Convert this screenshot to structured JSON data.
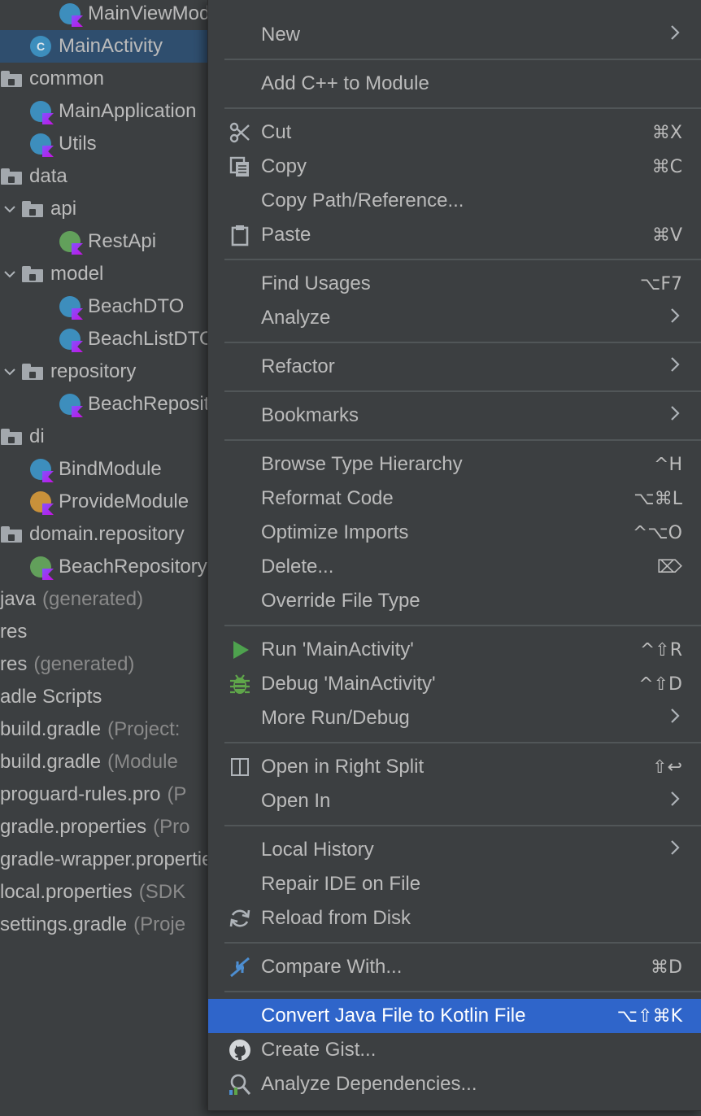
{
  "tree": {
    "rows": [
      {
        "label": "MainViewModel",
        "hint": "",
        "indent": 72,
        "icon": "kotlin-class-icon",
        "color": "blue",
        "arrow": ""
      },
      {
        "label": "MainActivity",
        "hint": "",
        "indent": 36,
        "icon": "java-class-icon",
        "color": "blue",
        "arrow": "",
        "selected": true
      },
      {
        "label": "common",
        "hint": "",
        "indent": 0,
        "icon": "package-folder-icon",
        "arrow": ""
      },
      {
        "label": "MainApplication",
        "hint": "",
        "indent": 36,
        "icon": "kotlin-class-icon",
        "color": "blue",
        "arrow": ""
      },
      {
        "label": "Utils",
        "hint": "",
        "indent": 36,
        "icon": "kotlin-class-icon",
        "color": "blue",
        "arrow": ""
      },
      {
        "label": "data",
        "hint": "",
        "indent": 0,
        "icon": "package-folder-icon",
        "arrow": ""
      },
      {
        "label": "api",
        "hint": "",
        "indent": 0,
        "icon": "package-folder-icon",
        "arrow": "down"
      },
      {
        "label": "RestApi",
        "hint": "",
        "indent": 72,
        "icon": "kotlin-interface-icon",
        "color": "green",
        "arrow": ""
      },
      {
        "label": "model",
        "hint": "",
        "indent": 0,
        "icon": "package-folder-icon",
        "arrow": "down"
      },
      {
        "label": "BeachDTO",
        "hint": "",
        "indent": 72,
        "icon": "kotlin-class-icon",
        "color": "blue",
        "arrow": ""
      },
      {
        "label": "BeachListDTO",
        "hint": "",
        "indent": 72,
        "icon": "kotlin-class-icon",
        "color": "blue",
        "arrow": ""
      },
      {
        "label": "repository",
        "hint": "",
        "indent": 0,
        "icon": "package-folder-icon",
        "arrow": "down"
      },
      {
        "label": "BeachRepositoryImpl",
        "hint": "",
        "indent": 72,
        "icon": "kotlin-class-icon",
        "color": "blue",
        "arrow": ""
      },
      {
        "label": "di",
        "hint": "",
        "indent": 0,
        "icon": "package-folder-icon",
        "arrow": ""
      },
      {
        "label": "BindModule",
        "hint": "",
        "indent": 36,
        "icon": "kotlin-abstract-class-icon",
        "color": "blue",
        "arrow": ""
      },
      {
        "label": "ProvideModule",
        "hint": "",
        "indent": 36,
        "icon": "kotlin-object-icon",
        "color": "orange",
        "arrow": ""
      },
      {
        "label": "domain.repository",
        "hint": "",
        "indent": 0,
        "icon": "package-folder-icon",
        "arrow": ""
      },
      {
        "label": "BeachRepository",
        "hint": "",
        "indent": 36,
        "icon": "kotlin-interface-icon",
        "color": "green",
        "arrow": ""
      },
      {
        "label": "java",
        "hint": "(generated)",
        "indent": 0,
        "icon": "",
        "arrow": ""
      },
      {
        "label": "res",
        "hint": "",
        "indent": 0,
        "icon": "",
        "arrow": ""
      },
      {
        "label": "res",
        "hint": "(generated)",
        "indent": 0,
        "icon": "",
        "arrow": ""
      },
      {
        "label": "adle Scripts",
        "hint": "",
        "indent": 0,
        "icon": "",
        "arrow": ""
      },
      {
        "label": "build.gradle",
        "hint": "(Project: ",
        "indent": 0,
        "icon": "",
        "arrow": ""
      },
      {
        "label": "build.gradle",
        "hint": "(Module",
        "indent": 0,
        "icon": "",
        "arrow": ""
      },
      {
        "label": "proguard-rules.pro",
        "hint": "(P",
        "indent": 0,
        "icon": "",
        "arrow": ""
      },
      {
        "label": "gradle.properties",
        "hint": "(Pro",
        "indent": 0,
        "icon": "",
        "arrow": ""
      },
      {
        "label": "gradle-wrapper.properties",
        "hint": "",
        "indent": 0,
        "icon": "",
        "arrow": ""
      },
      {
        "label": "local.properties",
        "hint": "(SDK",
        "indent": 0,
        "icon": "",
        "arrow": ""
      },
      {
        "label": "settings.gradle",
        "hint": "(Proje",
        "indent": 0,
        "icon": "",
        "arrow": ""
      }
    ]
  },
  "menu": {
    "items": [
      {
        "type": "item",
        "label": "New",
        "shortcut": "",
        "submenu": true,
        "icon": ""
      },
      {
        "type": "sep"
      },
      {
        "type": "item",
        "label": "Add C++ to Module",
        "shortcut": "",
        "submenu": false,
        "icon": ""
      },
      {
        "type": "sep"
      },
      {
        "type": "item",
        "label": "Cut",
        "shortcut": "⌘X",
        "submenu": false,
        "icon": "scissors-icon"
      },
      {
        "type": "item",
        "label": "Copy",
        "shortcut": "⌘C",
        "submenu": false,
        "icon": "copy-icon"
      },
      {
        "type": "item",
        "label": "Copy Path/Reference...",
        "shortcut": "",
        "submenu": false,
        "icon": ""
      },
      {
        "type": "item",
        "label": "Paste",
        "shortcut": "⌘V",
        "submenu": false,
        "icon": "clipboard-icon"
      },
      {
        "type": "sep"
      },
      {
        "type": "item",
        "label": "Find Usages",
        "shortcut": "⌥F7",
        "submenu": false,
        "icon": ""
      },
      {
        "type": "item",
        "label": "Analyze",
        "shortcut": "",
        "submenu": true,
        "icon": ""
      },
      {
        "type": "sep"
      },
      {
        "type": "item",
        "label": "Refactor",
        "shortcut": "",
        "submenu": true,
        "icon": ""
      },
      {
        "type": "sep"
      },
      {
        "type": "item",
        "label": "Bookmarks",
        "shortcut": "",
        "submenu": true,
        "icon": ""
      },
      {
        "type": "sep"
      },
      {
        "type": "item",
        "label": "Browse Type Hierarchy",
        "shortcut": "^H",
        "submenu": false,
        "icon": ""
      },
      {
        "type": "item",
        "label": "Reformat Code",
        "shortcut": "⌥⌘L",
        "submenu": false,
        "icon": ""
      },
      {
        "type": "item",
        "label": "Optimize Imports",
        "shortcut": "^⌥O",
        "submenu": false,
        "icon": ""
      },
      {
        "type": "item",
        "label": "Delete...",
        "shortcut": "⌦",
        "submenu": false,
        "icon": ""
      },
      {
        "type": "item",
        "label": "Override File Type",
        "shortcut": "",
        "submenu": false,
        "icon": ""
      },
      {
        "type": "sep"
      },
      {
        "type": "item",
        "label": "Run 'MainActivity'",
        "shortcut": "^⇧R",
        "submenu": false,
        "icon": "run-icon"
      },
      {
        "type": "item",
        "label": "Debug 'MainActivity'",
        "shortcut": "^⇧D",
        "submenu": false,
        "icon": "debug-bug-icon"
      },
      {
        "type": "item",
        "label": "More Run/Debug",
        "shortcut": "",
        "submenu": true,
        "icon": ""
      },
      {
        "type": "sep"
      },
      {
        "type": "item",
        "label": "Open in Right Split",
        "shortcut": "⇧↩",
        "submenu": false,
        "icon": "split-view-icon"
      },
      {
        "type": "item",
        "label": "Open In",
        "shortcut": "",
        "submenu": true,
        "icon": ""
      },
      {
        "type": "sep"
      },
      {
        "type": "item",
        "label": "Local History",
        "shortcut": "",
        "submenu": true,
        "icon": ""
      },
      {
        "type": "item",
        "label": "Repair IDE on File",
        "shortcut": "",
        "submenu": false,
        "icon": ""
      },
      {
        "type": "item",
        "label": "Reload from Disk",
        "shortcut": "",
        "submenu": false,
        "icon": "reload-icon"
      },
      {
        "type": "sep"
      },
      {
        "type": "item",
        "label": "Compare With...",
        "shortcut": "⌘D",
        "submenu": false,
        "icon": "compare-arrows-icon"
      },
      {
        "type": "sep"
      },
      {
        "type": "item",
        "label": "Convert Java File to Kotlin File",
        "shortcut": "⌥⇧⌘K",
        "submenu": false,
        "icon": "",
        "active": true
      },
      {
        "type": "item",
        "label": "Create Gist...",
        "shortcut": "",
        "submenu": false,
        "icon": "github-icon"
      },
      {
        "type": "item",
        "label": "Analyze Dependencies...",
        "shortcut": "",
        "submenu": false,
        "icon": "analyze-dependencies-icon"
      }
    ]
  },
  "colors": {
    "menu_bg": "#3c3f41",
    "highlight": "#2f65ca",
    "tree_selection": "#2f4e6e",
    "text": "#bbbbbb",
    "run_green": "#4ea24e",
    "debug_green": "#5fa64a"
  }
}
